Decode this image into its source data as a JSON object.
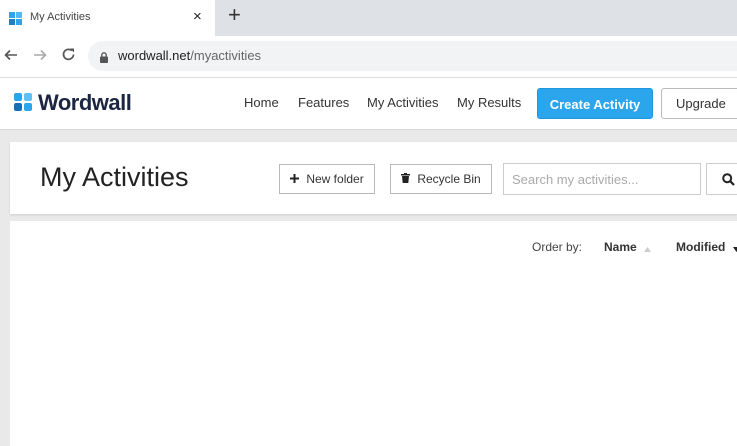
{
  "browser": {
    "tab_title": "My Activities",
    "tab_close": "×",
    "new_tab": "+",
    "url_host": "wordwall.net",
    "url_path": "/myactivities",
    "back_icon": "arrow-left-icon",
    "forward_icon": "arrow-right-icon",
    "reload_icon": "reload-icon"
  },
  "site": {
    "logo_text": "Wordwall",
    "nav": [
      "Home",
      "Features",
      "My Activities",
      "My Results"
    ],
    "create_label": "Create Activity",
    "upgrade_label": "Upgrade",
    "colors": {
      "brand_blue": "#2ba6ed",
      "logo_dark": "#1c2541"
    }
  },
  "toolbar": {
    "title": "My Activities",
    "new_folder_label": "New folder",
    "recycle_bin_label": "Recycle Bin",
    "search_placeholder": "Search my activities..."
  },
  "sort": {
    "label": "Order by:",
    "name": "Name",
    "modified": "Modified"
  }
}
